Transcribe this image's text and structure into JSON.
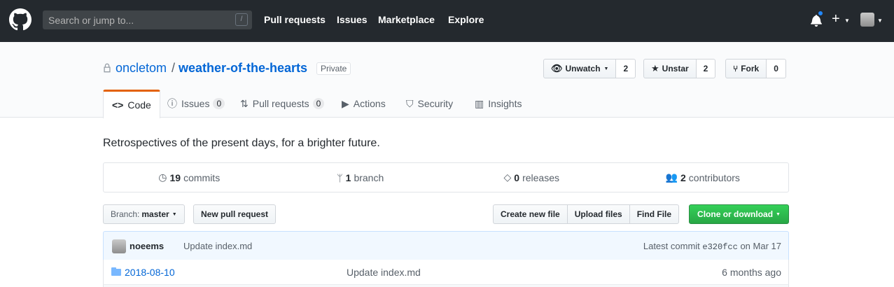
{
  "header": {
    "search_placeholder": "Search or jump to...",
    "search_shortcut": "/",
    "nav": [
      "Pull requests",
      "Issues",
      "Marketplace",
      "Explore"
    ],
    "plus": "+"
  },
  "repo": {
    "owner": "oncletom",
    "separator": "/",
    "name": "weather-of-the-hearts",
    "visibility": "Private",
    "watch_label": "Unwatch",
    "watch_count": "2",
    "star_label": "Unstar",
    "star_count": "2",
    "fork_label": "Fork",
    "fork_count": "0"
  },
  "tabs": [
    {
      "label": "Code",
      "icon": "code-icon"
    },
    {
      "label": "Issues",
      "icon": "issue-icon",
      "count": "0"
    },
    {
      "label": "Pull requests",
      "icon": "pull-request-icon",
      "count": "0"
    },
    {
      "label": "Actions",
      "icon": "play-icon"
    },
    {
      "label": "Security",
      "icon": "shield-icon"
    },
    {
      "label": "Insights",
      "icon": "graph-icon"
    }
  ],
  "description": "Retrospectives of the present days, for a brighter future.",
  "summary": [
    {
      "num": "19",
      "label": "commits",
      "icon": "history-icon"
    },
    {
      "num": "1",
      "label": "branch",
      "icon": "branch-icon"
    },
    {
      "num": "0",
      "label": "releases",
      "icon": "tag-icon"
    },
    {
      "num": "2",
      "label": "contributors",
      "icon": "people-icon"
    }
  ],
  "toolbar": {
    "branch_prefix": "Branch:",
    "branch": "master",
    "new_pr": "New pull request",
    "create_file": "Create new file",
    "upload": "Upload files",
    "find": "Find File",
    "clone": "Clone or download"
  },
  "latest_commit": {
    "author": "noeems",
    "message": "Update index.md",
    "prefix": "Latest commit",
    "sha": "e320fcc",
    "date": "on Mar 17"
  },
  "files": [
    {
      "name": "2018-08-10",
      "message": "Update index.md",
      "age": "6 months ago",
      "icon": "folder-icon"
    }
  ],
  "colors": {
    "header_bg": "#24292e",
    "link": "#0366d6",
    "clone_green": "#28a745",
    "tab_accent": "#e36209"
  }
}
